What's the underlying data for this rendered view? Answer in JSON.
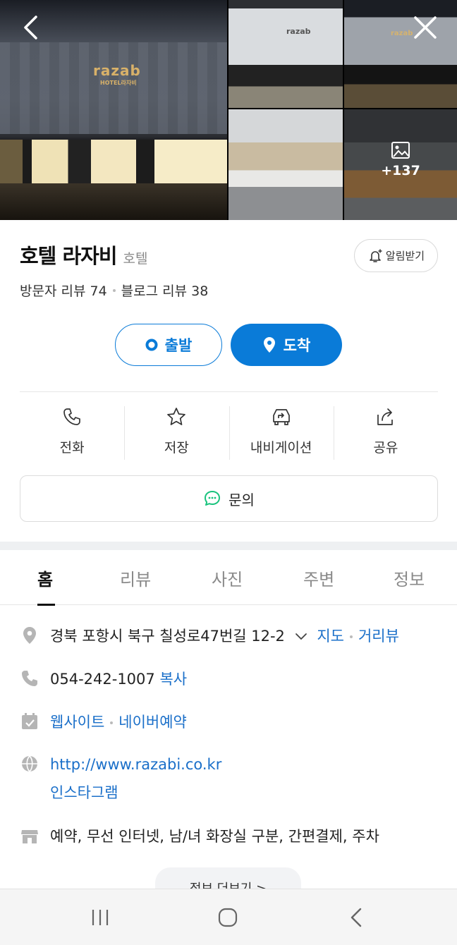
{
  "gallery": {
    "main_sign": "razab",
    "main_sign_sub": "HOTEL라자비",
    "thumb1_sign": "razab",
    "thumb2_sign": "razab",
    "more_count": "+137",
    "icons": {
      "back": "back-arrow-icon",
      "close": "close-icon",
      "photos": "photo-gallery-icon"
    }
  },
  "header": {
    "name": "호텔 라자비",
    "category": "호텔",
    "alarm_label": "알림받기",
    "visitor_reviews": "방문자 리뷰 74",
    "blog_reviews": "블로그 리뷰 38"
  },
  "route": {
    "start_label": "출발",
    "end_label": "도착"
  },
  "actions": [
    {
      "label": "전화",
      "icon": "phone-icon"
    },
    {
      "label": "저장",
      "icon": "star-icon"
    },
    {
      "label": "내비게이션",
      "icon": "car-navigation-icon"
    },
    {
      "label": "공유",
      "icon": "share-icon"
    }
  ],
  "ask_label": "문의",
  "tabs": [
    {
      "label": "홈",
      "active": true
    },
    {
      "label": "리뷰"
    },
    {
      "label": "사진"
    },
    {
      "label": "주변"
    },
    {
      "label": "정보"
    }
  ],
  "info": {
    "address": "경북 포항시 북구 칠성로47번길 12-2",
    "map_label": "지도",
    "roadview_label": "거리뷰",
    "phone": "054-242-1007",
    "copy_label": "복사",
    "website_label": "웹사이트",
    "naver_booking_label": "네이버예약",
    "homepage_url": "http://www.razabi.co.kr",
    "instagram_label": "인스타그램",
    "amenities": "예약, 무선 인터넷, 남/녀 화장실 구분, 간편결제, 주차",
    "more_label": "정보 더보기 >"
  },
  "colors": {
    "accent": "#0a7bd8",
    "link": "#1a6fc9",
    "ask_icon": "#19c37d"
  }
}
